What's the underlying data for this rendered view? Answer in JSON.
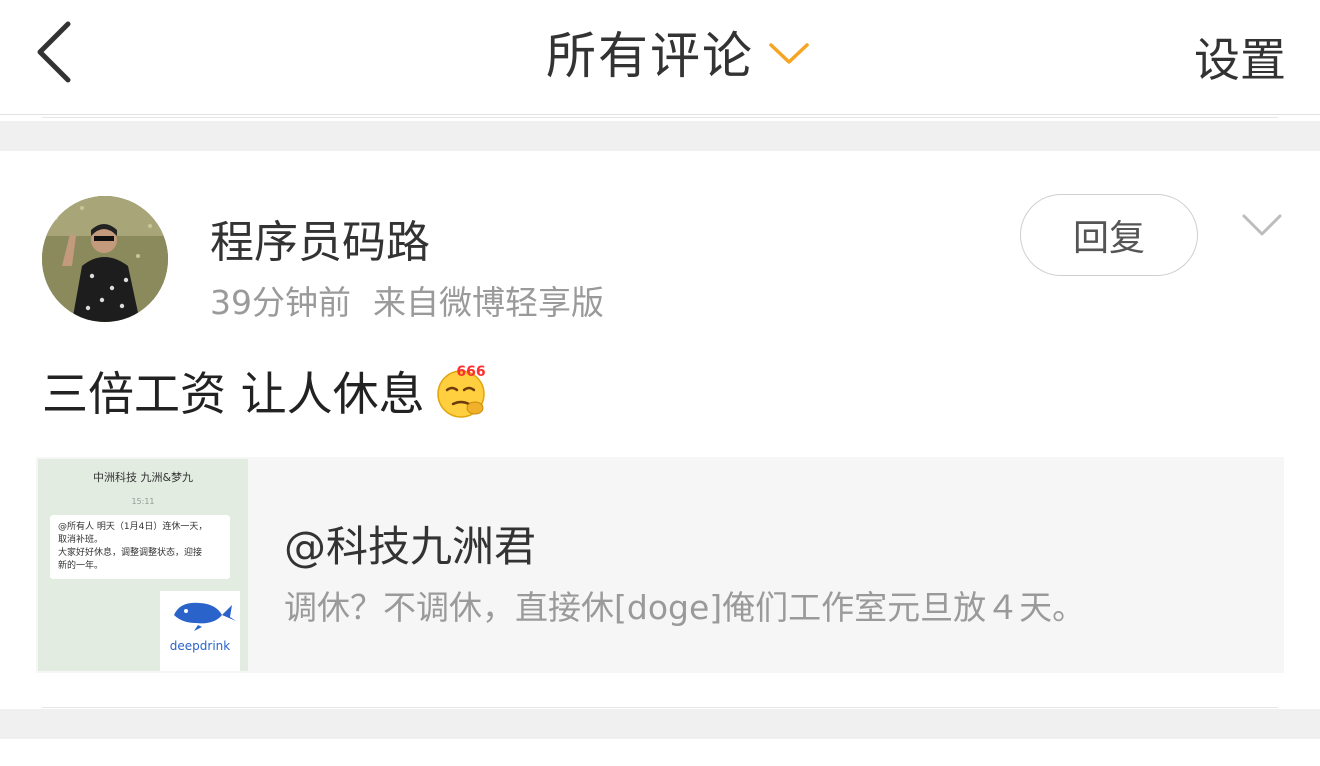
{
  "header": {
    "title": "所有评论",
    "settings_label": "设置",
    "accent_color": "#f5a623"
  },
  "post": {
    "username": "程序员码路",
    "time": "39分钟前",
    "source": "来自微博轻享版",
    "reply_label": "回复",
    "text": "三倍工资 让人休息",
    "emoji": "666-emoji-icon",
    "emoji_text": "666"
  },
  "quote": {
    "user": "@科技九洲君",
    "text": "调休？不调休，直接休[doge]俺们工作室元旦放４天。",
    "thumbnail": {
      "chat_title": "中洲科技 九洲&梦九",
      "time": "15:11",
      "message": "@所有人 明天（1月4日）连休一天，\n取消补班。\n大家好好休息，调整调整状态，迎接\n新的一年。",
      "logo_text": "deepdrink"
    }
  }
}
